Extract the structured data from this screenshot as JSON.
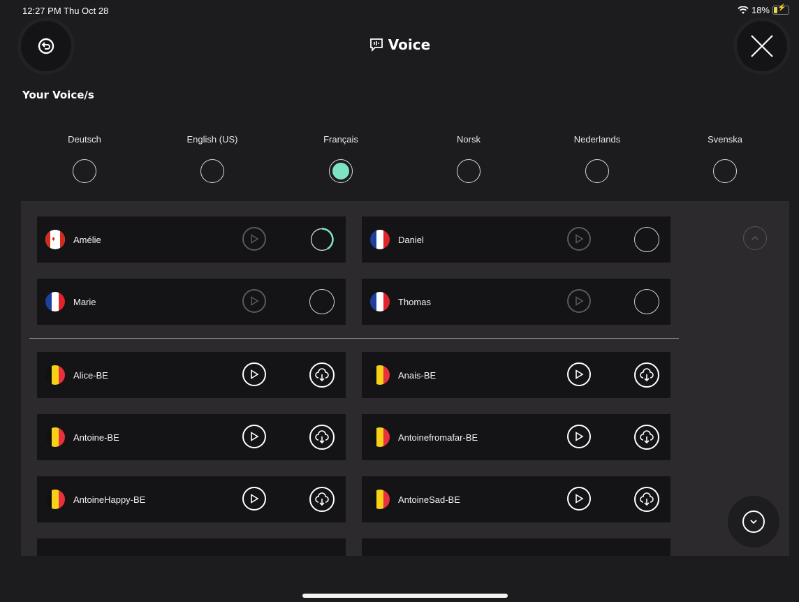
{
  "status": {
    "time": "12:27 PM  Thu Oct 28",
    "wifi": "wifi-icon",
    "battery_pct": "18%"
  },
  "header": {
    "title": "Voice",
    "title_icon": "voice-chat-icon",
    "back_icon": "back-icon",
    "close_icon": "close-icon"
  },
  "section_label": "Your Voice/s",
  "languages": [
    {
      "label": "Deutsch",
      "selected": false
    },
    {
      "label": "English (US)",
      "selected": false
    },
    {
      "label": "Français",
      "selected": true
    },
    {
      "label": "Norsk",
      "selected": false
    },
    {
      "label": "Nederlands",
      "selected": false
    },
    {
      "label": "Svenska",
      "selected": false
    }
  ],
  "installed_voices": [
    {
      "name": "Amélie",
      "flag": "ca",
      "state": "loading"
    },
    {
      "name": "Daniel",
      "flag": "fr",
      "state": "empty"
    },
    {
      "name": "Marie",
      "flag": "fr",
      "state": "empty"
    },
    {
      "name": "Thomas",
      "flag": "fr",
      "state": "empty"
    }
  ],
  "available_voices": [
    {
      "name": "Alice-BE",
      "flag": "be",
      "state": "download"
    },
    {
      "name": "Anais-BE",
      "flag": "be",
      "state": "download"
    },
    {
      "name": "Antoine-BE",
      "flag": "be",
      "state": "download"
    },
    {
      "name": "Antoinefromafar-BE",
      "flag": "be",
      "state": "download"
    },
    {
      "name": "AntoineHappy-BE",
      "flag": "be",
      "state": "download"
    },
    {
      "name": "AntoineSad-BE",
      "flag": "be",
      "state": "download"
    }
  ],
  "colors": {
    "accent": "#7ee3c4",
    "background": "#1c1b1d",
    "panel": "#2c2a2d",
    "card": "#141315"
  }
}
